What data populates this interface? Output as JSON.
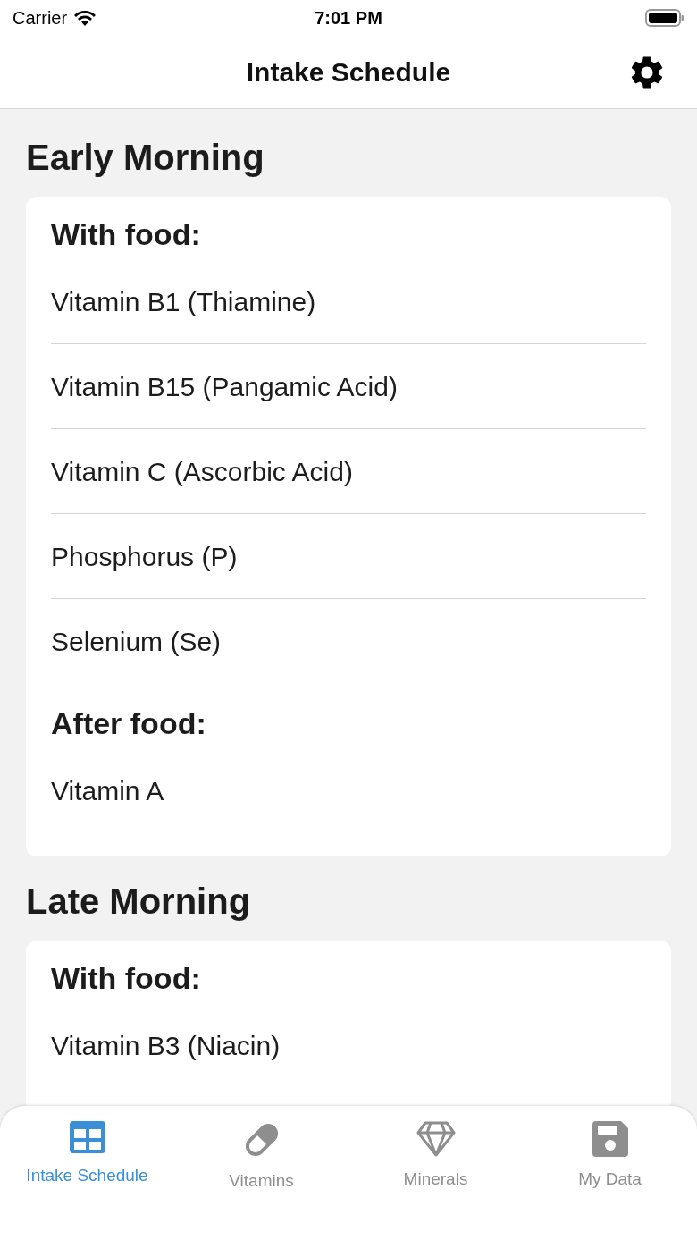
{
  "status_bar": {
    "carrier": "Carrier",
    "time": "7:01 PM"
  },
  "nav": {
    "title": "Intake Schedule"
  },
  "sections": [
    {
      "title": "Early Morning",
      "groups": [
        {
          "label": "With food:",
          "items": [
            "Vitamin B1 (Thiamine)",
            "Vitamin B15 (Pangamic Acid)",
            "Vitamin C (Ascorbic Acid)",
            "Phosphorus (P)",
            "Selenium (Se)"
          ]
        },
        {
          "label": "After food:",
          "items": [
            "Vitamin A"
          ]
        }
      ]
    },
    {
      "title": "Late Morning",
      "groups": [
        {
          "label": "With food:",
          "items": [
            "Vitamin B3 (Niacin)"
          ]
        }
      ]
    }
  ],
  "tabs": [
    {
      "label": "Intake Schedule",
      "kind": "grid",
      "selected": true
    },
    {
      "label": "Vitamins",
      "kind": "pill",
      "selected": false
    },
    {
      "label": "Minerals",
      "kind": "diamond",
      "selected": false
    },
    {
      "label": "My Data",
      "kind": "disk",
      "selected": false
    }
  ]
}
